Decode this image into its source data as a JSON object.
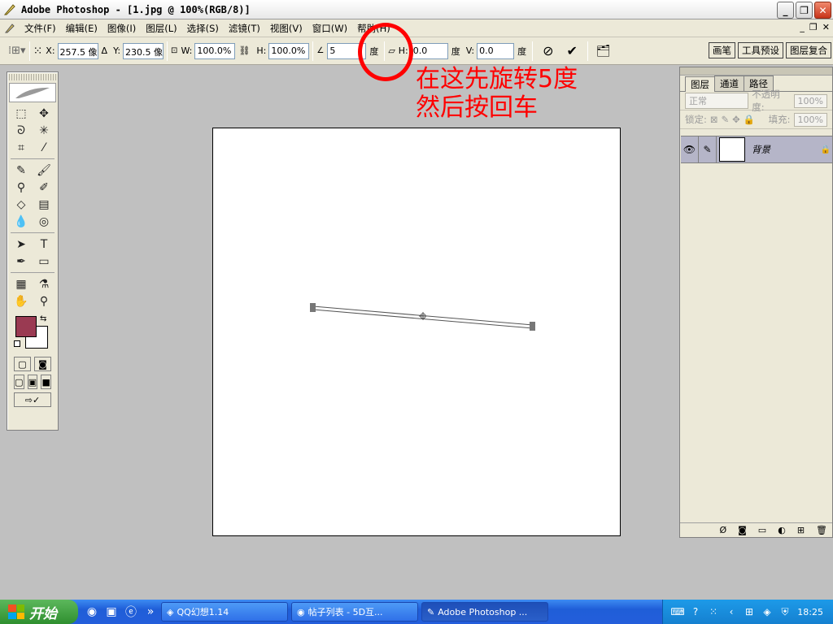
{
  "window": {
    "title": "Adobe Photoshop - [1.jpg @ 100%(RGB/8)]"
  },
  "menu": [
    "文件(F)",
    "编辑(E)",
    "图像(I)",
    "图层(L)",
    "选择(S)",
    "滤镜(T)",
    "视图(V)",
    "窗口(W)",
    "帮助(H)"
  ],
  "options": {
    "x_label": "X:",
    "x_value": "257.5 像",
    "y_label": "Y:",
    "y_value": "230.5 像",
    "w_label": "W:",
    "w_value": "100.0%",
    "h_label": "H:",
    "h_value": "100.0%",
    "angle_value": "5",
    "angle_unit": "度",
    "hskew_label": "H:",
    "hskew_value": "0.0",
    "hskew_unit": "度",
    "vskew_label": "V:",
    "vskew_value": "0.0",
    "vskew_unit": "度"
  },
  "palette_well": {
    "tabs": [
      "画笔",
      "工具预设",
      "图层复合"
    ]
  },
  "annotation": {
    "line1": "在这先旋转5度",
    "line2": "然后按回车"
  },
  "layers_panel": {
    "tabs": [
      "图层",
      "通道",
      "路径"
    ],
    "blend_mode": "正常",
    "opacity_label": "不透明度:",
    "opacity_value": "100%",
    "lock_label": "锁定:",
    "fill_label": "填充:",
    "fill_value": "100%",
    "layer_name": "背景"
  },
  "taskbar": {
    "start_label": "开始",
    "tasks": [
      "QQ幻想1.14",
      "帖子列表 - 5D互...",
      "Adobe Photoshop ..."
    ],
    "clock": "18:25"
  },
  "colors": {
    "foreground": "#9a3a52",
    "background": "#ffffff",
    "annotation": "#ff0000"
  }
}
